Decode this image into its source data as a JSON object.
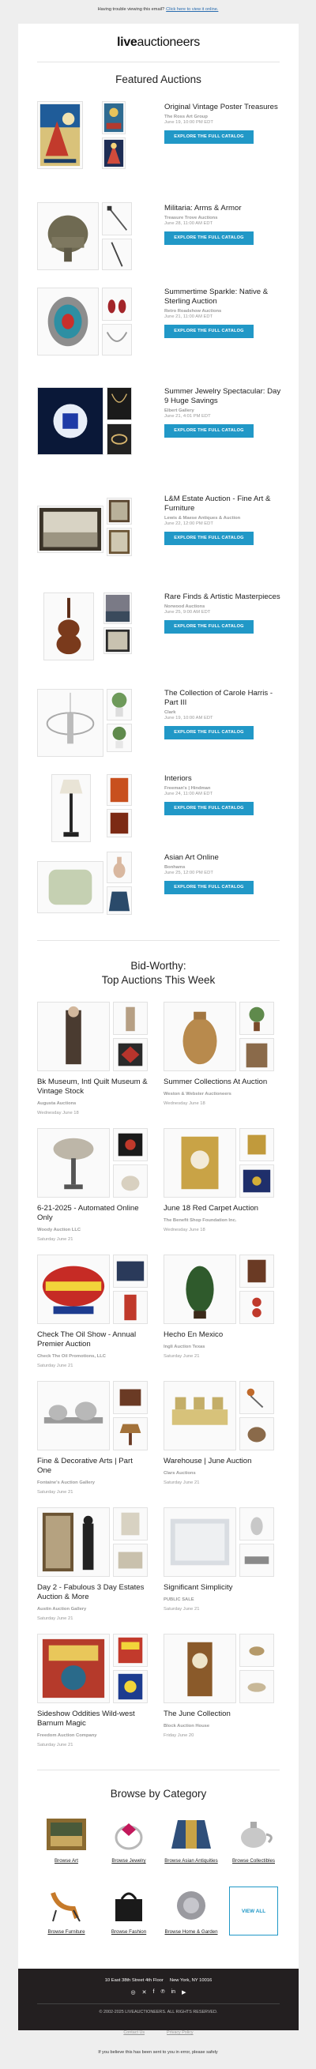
{
  "preheader": {
    "text": "Having trouble viewing this email?",
    "link": "Click here to view it online."
  },
  "logo": {
    "bold": "live",
    "light": "auctioneers"
  },
  "featured": {
    "title": "Featured Auctions",
    "button_label": "EXPLORE THE FULL CATALOG",
    "items": [
      {
        "title": "Original Vintage Poster Treasures",
        "house": "The Ross Art Group",
        "date": "June 19, 10:00 PM EDT"
      },
      {
        "title": "Militaria: Arms & Armor",
        "house": "Treasure Trove Auctions",
        "date": "June 28, 11:00 AM EDT"
      },
      {
        "title": "Summertime Sparkle: Native & Sterling Auction",
        "house": "Retro Roadshow Auctions",
        "date": "June 21, 11:00 AM EDT"
      },
      {
        "title": "Summer Jewelry Spectacular: Day 9 Huge Savings",
        "house": "Elbert Gallery",
        "date": "June 21, 4:01 PM EDT"
      },
      {
        "title": "L&M Estate Auction - Fine Art & Furniture",
        "house": "Lewis & Maese Antiques & Auction",
        "date": "June 22, 12:00 PM EDT"
      },
      {
        "title": "Rare Finds & Artistic Masterpieces",
        "house": "Norwood Auctions",
        "date": "June 25, 9:00 AM EDT"
      },
      {
        "title": "The Collection of Carole Harris - Part III",
        "house": "Clark",
        "date": "June 19, 10:00 AM EDT"
      },
      {
        "title": "Interiors",
        "house": "Freeman's | Hindman",
        "date": "June 24, 11:00 AM EDT"
      },
      {
        "title": "Asian Art Online",
        "house": "Bonhams",
        "date": "June 25, 12:00 PM EDT"
      }
    ]
  },
  "bidworthy": {
    "title_line1": "Bid-Worthy:",
    "title_line2": "Top Auctions This Week",
    "items": [
      {
        "title": "Bk Museum, Intl Quilt Museum & Vintage Stock",
        "house": "Augusta Auctions",
        "date": "Wednesday June 18"
      },
      {
        "title": "Summer Collections At Auction",
        "house": "Weston & Webster Auctioneers",
        "date": "Wednesday June 18"
      },
      {
        "title": "6-21-2025 - Automated Online Only",
        "house": "Woody Auction LLC",
        "date": "Saturday June 21"
      },
      {
        "title": "June 18 Red Carpet Auction",
        "house": "The Benefit Shop Foundation Inc.",
        "date": "Wednesday June 18"
      },
      {
        "title": "Check The Oil Show - Annual Premier Auction",
        "house": "Check The Oil Promotions, LLC",
        "date": "Saturday June 21"
      },
      {
        "title": "Hecho En Mexico",
        "house": "Ingli Auction Texas",
        "date": "Saturday June 21"
      },
      {
        "title": "Fine & Decorative Arts | Part One",
        "house": "Fontaine's Auction Gallery",
        "date": "Saturday June 21"
      },
      {
        "title": "Warehouse | June Auction",
        "house": "Clars Auctions",
        "date": "Saturday June 21"
      },
      {
        "title": "Day 2 - Fabulous 3 Day Estates Auction & More",
        "house": "Austin Auction Gallery",
        "date": "Saturday June 21"
      },
      {
        "title": "Significant Simplicity",
        "house": "PUBLIC SALE",
        "date": "Saturday June 21"
      },
      {
        "title": "Sideshow Oddities Wild-west Barnum Magic",
        "house": "Freedom Auction Company",
        "date": "Saturday June 21"
      },
      {
        "title": "The June Collection",
        "house": "Block Auction House",
        "date": "Friday June 20"
      }
    ]
  },
  "categories": {
    "title": "Browse by Category",
    "items": [
      "Browse Art",
      "Browse Jewelry",
      "Browse Asian Antiquities",
      "Browse Collectibles",
      "Browse Furniture",
      "Browse Fashion",
      "Browse Home & Garden"
    ],
    "view_all": "VIEW ALL"
  },
  "footer": {
    "address_left": "10 East 38th Street 4th Floor",
    "address_right": "New York, NY 10016",
    "social_icons": [
      "instagram-icon",
      "x-icon",
      "facebook-icon",
      "pinterest-icon",
      "linkedin-icon",
      "youtube-icon"
    ],
    "copyright": "© 2002-2025 LIVEAUCTIONEERS. ALL RIGHTS RESERVED.",
    "link_left": "Contact Us",
    "link_right": "Privacy Policy"
  },
  "bottom_note": "If you believe this has been sent to you in error, please safely",
  "colors": {
    "accent": "#2198c7",
    "footer_bg": "#231f20",
    "page_bg": "#eeeeee"
  }
}
